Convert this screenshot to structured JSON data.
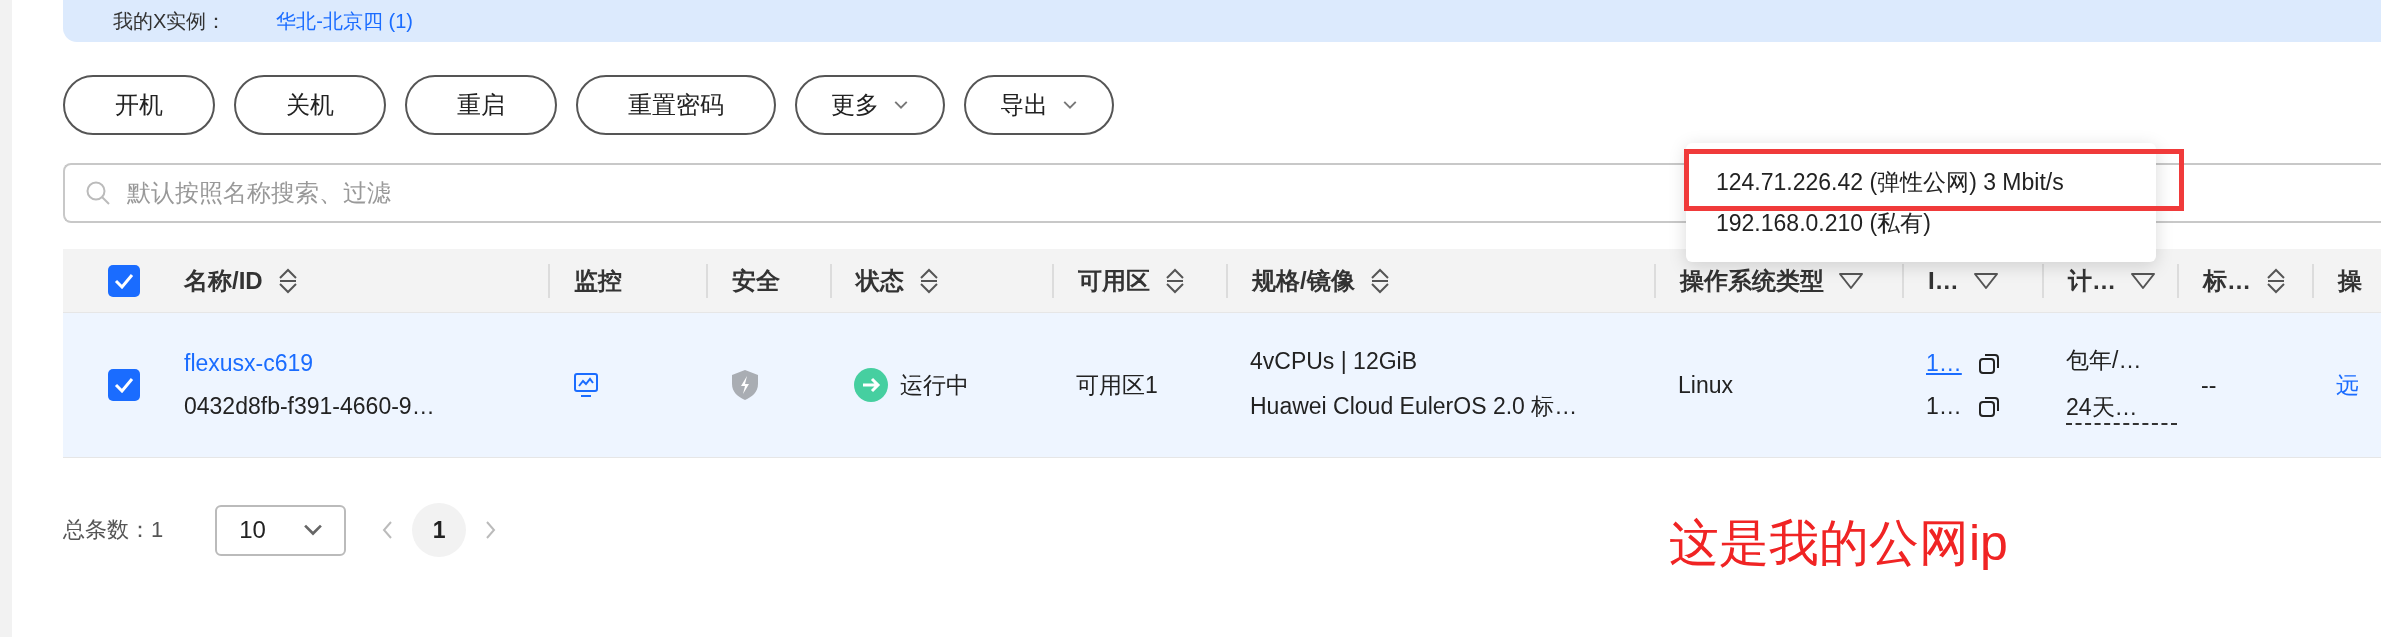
{
  "banner": {
    "label": "我的X实例：",
    "value": "华北-北京四 (1)"
  },
  "toolbar": [
    {
      "label": "开机",
      "dropdown": false
    },
    {
      "label": "关机",
      "dropdown": false
    },
    {
      "label": "重启",
      "dropdown": false
    },
    {
      "label": "重置密码",
      "dropdown": false
    },
    {
      "label": "更多",
      "dropdown": true
    },
    {
      "label": "导出",
      "dropdown": true
    }
  ],
  "search": {
    "placeholder": "默认按照名称搜索、过滤"
  },
  "table": {
    "select_all": {
      "checked": true
    },
    "columns": [
      {
        "label": "名称/ID",
        "sortable": true,
        "filterable": false
      },
      {
        "label": "监控",
        "sortable": false,
        "filterable": false
      },
      {
        "label": "安全",
        "sortable": false,
        "filterable": false
      },
      {
        "label": "状态",
        "sortable": true,
        "filterable": false
      },
      {
        "label": "可用区",
        "sortable": true,
        "filterable": false
      },
      {
        "label": "规格/镜像",
        "sortable": true,
        "filterable": false
      },
      {
        "label": "操作系统类型",
        "sortable": false,
        "filterable": true
      },
      {
        "label": "I…",
        "sortable": false,
        "filterable": true
      },
      {
        "label": "计…",
        "sortable": false,
        "filterable": true
      },
      {
        "label": "标…",
        "sortable": true,
        "filterable": false
      },
      {
        "label": "操",
        "sortable": false,
        "filterable": false
      }
    ],
    "rows": [
      {
        "selected": true,
        "name": "flexusx-c619",
        "id": "0432d8fb-f391-4660-9…",
        "status": "运行中",
        "zone": "可用区1",
        "spec": "4vCPUs | 12GiB",
        "image": "Huawei Cloud EulerOS 2.0 标…",
        "os": "Linux",
        "ip_1": "1…",
        "ip_2": "1…",
        "billing_1": "包年/…",
        "billing_2": "24天…",
        "tag": "--",
        "action": "远"
      }
    ]
  },
  "ip_tooltip": {
    "lines": [
      {
        "text": "124.71.226.42 (弹性公网) 3 Mbit/s",
        "highlighted": true
      },
      {
        "text": "192.168.0.210 (私有)",
        "highlighted": false
      }
    ]
  },
  "annotation": {
    "text": "这是我的公网ip"
  },
  "pagination": {
    "total_label": "总条数：",
    "total": "1",
    "page_size": "10",
    "pages": [
      {
        "label": "1",
        "selected": true
      }
    ]
  }
}
